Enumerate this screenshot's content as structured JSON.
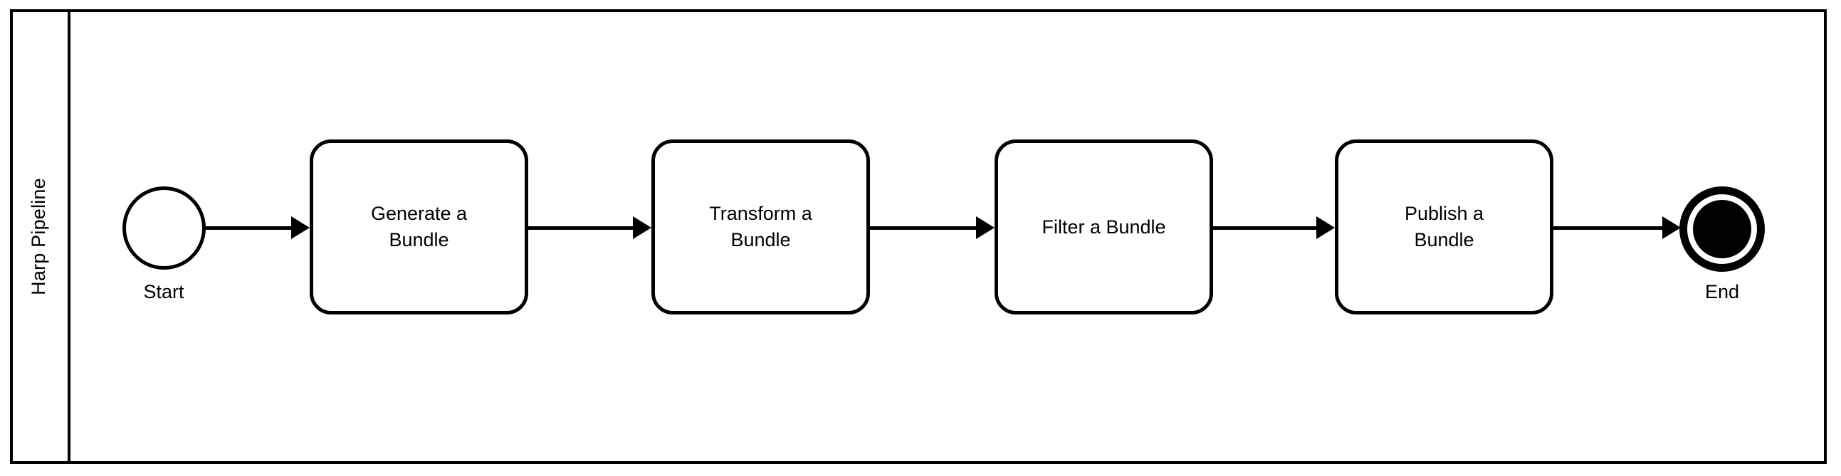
{
  "diagram": {
    "type": "bpmn-pipeline",
    "lane": {
      "title": "Harp Pipeline"
    },
    "events": [
      {
        "id": "start",
        "kind": "start-event",
        "label": "Start"
      },
      {
        "id": "end",
        "kind": "end-event",
        "label": "End"
      }
    ],
    "tasks": [
      {
        "id": "generate",
        "line1": "Generate a",
        "line2": "Bundle"
      },
      {
        "id": "transform",
        "line1": "Transform a",
        "line2": "Bundle"
      },
      {
        "id": "filter",
        "line1": "Filter a Bundle",
        "line2": ""
      },
      {
        "id": "publish",
        "line1": "Publish a",
        "line2": "Bundle"
      }
    ],
    "flows": [
      {
        "id": "f1",
        "from": "Start",
        "to": "Generate a Bundle"
      },
      {
        "id": "f2",
        "from": "Generate a Bundle",
        "to": "Transform a Bundle"
      },
      {
        "id": "f3",
        "from": "Transform a Bundle",
        "to": "Filter a Bundle"
      },
      {
        "id": "f4",
        "from": "Filter a Bundle",
        "to": "Publish a Bundle"
      },
      {
        "id": "f5",
        "from": "Publish a Bundle",
        "to": "End"
      }
    ],
    "colors": {
      "stroke": "#000000",
      "fill": "#ffffff"
    }
  }
}
